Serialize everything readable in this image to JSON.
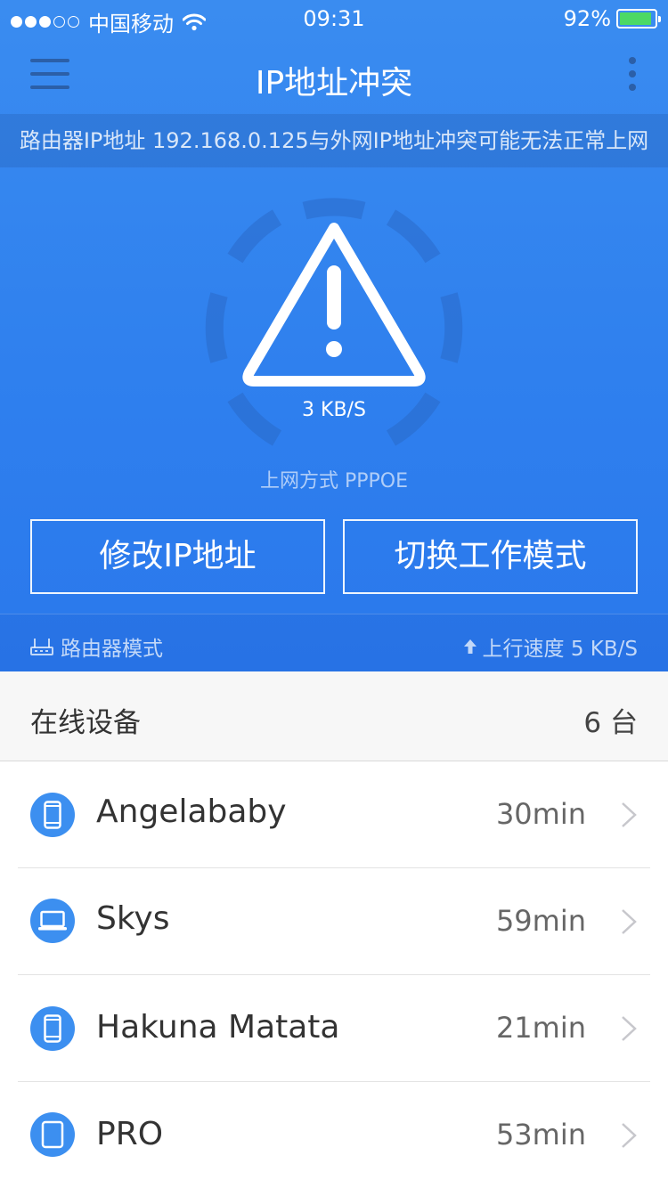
{
  "status_bar": {
    "carrier": "中国移动",
    "time": "09:31",
    "battery": "92%",
    "battery_level": 0.92
  },
  "nav": {
    "title": "IP地址冲突"
  },
  "alert": {
    "message": "路由器IP地址 192.168.0.125与外网IP地址冲突可能无法正常上网"
  },
  "gauge": {
    "speed": "3 KB/S",
    "connection_mode": "上网方式 PPPOE"
  },
  "actions": {
    "modify_ip": "修改IP地址",
    "switch_mode": "切换工作模式"
  },
  "footer": {
    "router_mode": "路由器模式",
    "upload_speed": "上行速度 5 KB/S"
  },
  "online": {
    "title": "在线设备",
    "count": "6 台"
  },
  "devices": [
    {
      "name": "Angelababy",
      "time": "30min",
      "icon": "phone-icon"
    },
    {
      "name": "Skys",
      "time": "59min",
      "icon": "laptop-icon"
    },
    {
      "name": "Hakuna Matata",
      "time": "21min",
      "icon": "phone-icon"
    },
    {
      "name": "PRO",
      "time": "53min",
      "icon": "tablet-icon"
    }
  ],
  "colors": {
    "primary": "#2f80ee",
    "battery_green": "#4cd964",
    "device_icon_bg": "#3c8ff0"
  }
}
